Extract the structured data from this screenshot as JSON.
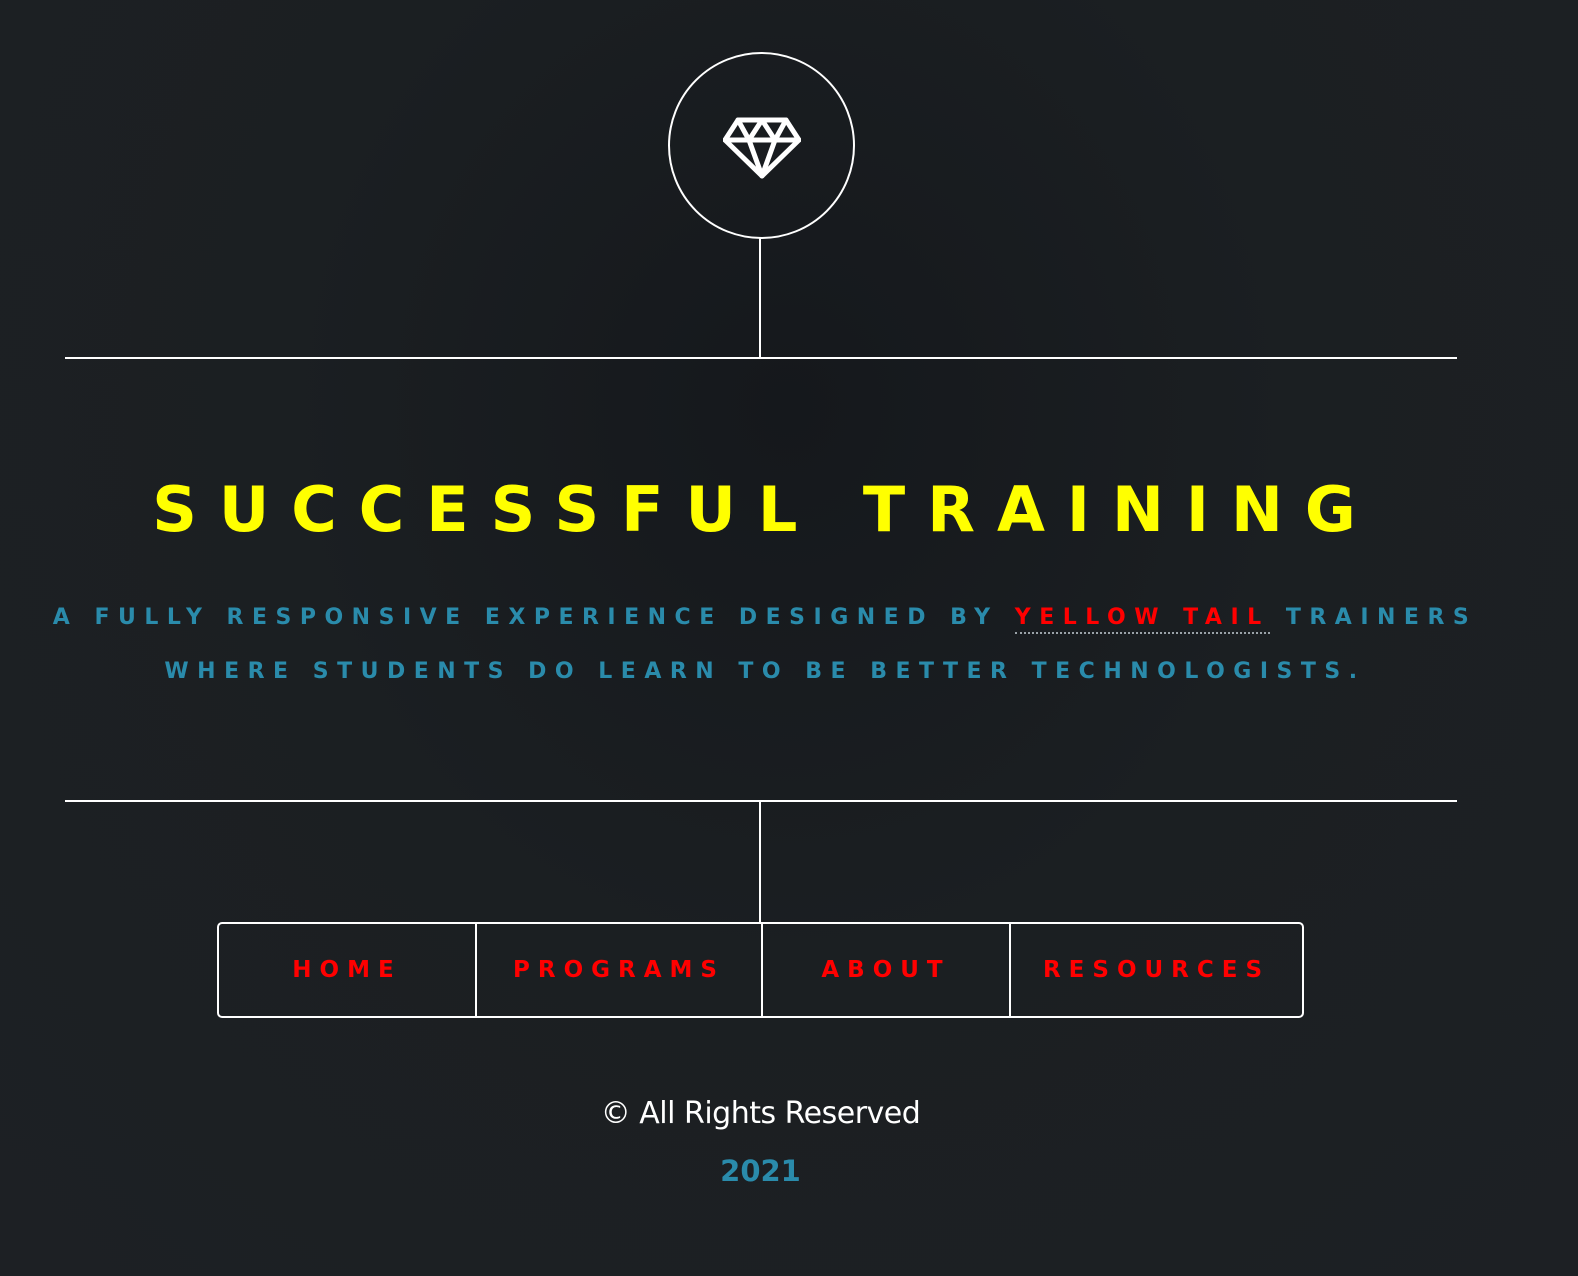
{
  "logo": {
    "icon": "diamond-icon"
  },
  "hero": {
    "title": "SUCCESSFUL TRAINING",
    "subtitle_line1_before": "A FULLY RESPONSIVE EXPERIENCE DESIGNED BY",
    "subtitle_link": "YELLOW TAIL",
    "subtitle_line1_after": "TRAINERS",
    "subtitle_line2": "WHERE STUDENTS DO LEARN TO BE BETTER TECHNOLOGISTS."
  },
  "nav": {
    "items": [
      {
        "label": "HOME"
      },
      {
        "label": "PROGRAMS"
      },
      {
        "label": "ABOUT"
      },
      {
        "label": "RESOURCES"
      }
    ]
  },
  "footer": {
    "copyright": "© All Rights Reserved",
    "year": "2021"
  },
  "colors": {
    "background": "#1b1f22",
    "title": "#ffff00",
    "subtitle": "#2a8bab",
    "accent": "#ff0000",
    "lines": "#ffffff"
  }
}
